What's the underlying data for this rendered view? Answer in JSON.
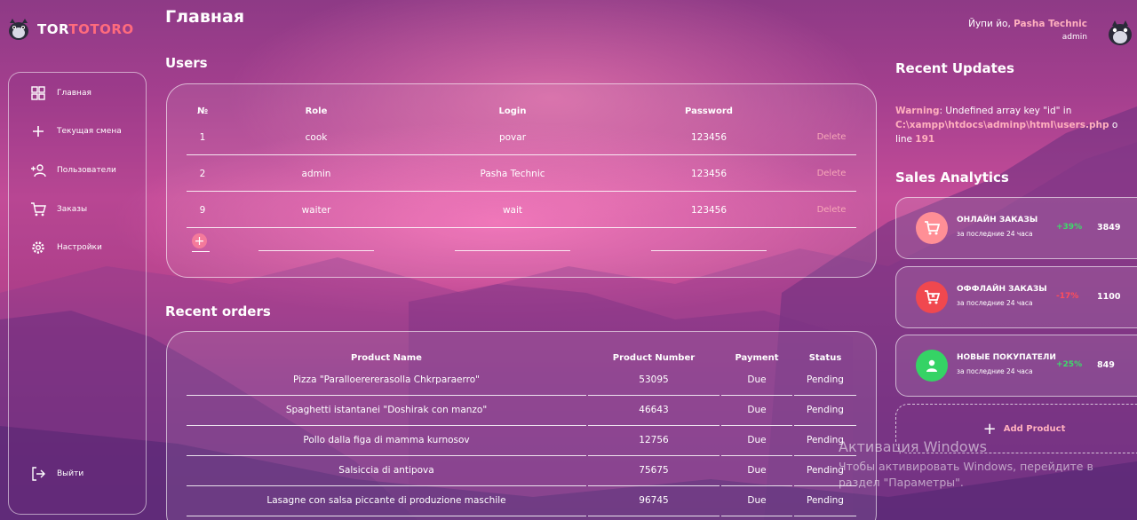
{
  "brand": {
    "part_a": "TOR",
    "part_b": "TOTORO"
  },
  "page_title": "Главная",
  "nav": {
    "home": "Главная",
    "shift": "Текущая смена",
    "users": "Пользователи",
    "orders": "Заказы",
    "settings": "Настройки",
    "logout": "Выйти"
  },
  "users": {
    "title": "Users",
    "headers": {
      "num": "№",
      "role": "Role",
      "login": "Login",
      "password": "Password"
    },
    "rows": [
      {
        "num": "1",
        "role": "cook",
        "login": "povar",
        "password": "123456",
        "action": "Delete"
      },
      {
        "num": "2",
        "role": "admin",
        "login": "Pasha Technic",
        "password": "123456",
        "action": "Delete"
      },
      {
        "num": "9",
        "role": "waiter",
        "login": "wait",
        "password": "123456",
        "action": "Delete"
      }
    ],
    "add_symbol": "+"
  },
  "orders": {
    "title": "Recent orders",
    "headers": {
      "name": "Product Name",
      "number": "Product Number",
      "payment": "Payment",
      "status": "Status"
    },
    "rows": [
      {
        "name": "Pizza \"Paralloerererasolla Chkrparaerro\"",
        "number": "53095",
        "payment": "Due",
        "status": "Pending"
      },
      {
        "name": "Spaghetti istantanei \"Doshirak con manzo\"",
        "number": "46643",
        "payment": "Due",
        "status": "Pending"
      },
      {
        "name": "Pollo dalla figa di mamma kurnosov",
        "number": "12756",
        "payment": "Due",
        "status": "Pending"
      },
      {
        "name": "Salsiccia di antipova",
        "number": "75675",
        "payment": "Due",
        "status": "Pending"
      },
      {
        "name": "Lasagne con salsa piccante di produzione maschile",
        "number": "96745",
        "payment": "Due",
        "status": "Pending"
      }
    ]
  },
  "user_info": {
    "greeting": "Йупи йо, ",
    "name": "Pasha Technic",
    "role": "admin"
  },
  "updates": {
    "title": "Recent Updates",
    "warning_label": "Warning",
    "warning_text": ": Undefined array key \"id\" in",
    "path": "C:\\xampp\\htdocs\\adminp\\html\\users.php",
    "path_suffix": " o",
    "line_prefix": "line ",
    "line_num": "191"
  },
  "sales": {
    "title": "Sales Analytics",
    "cards": [
      {
        "title": "ОНЛАЙН ЗАКАЗЫ",
        "subtitle": "за последние 24 часа",
        "percent": "+39%",
        "value": "3849",
        "color": "#ff8f96",
        "pct_color": "#3ddc6a"
      },
      {
        "title": "ОФФЛАЙН ЗАКАЗЫ",
        "subtitle": "за последние 24 часа",
        "percent": "-17%",
        "value": "1100",
        "color": "#f0484f",
        "pct_color": "#ff4d5a"
      },
      {
        "title": "НОВЫЕ ПОКУПАТЕЛИ",
        "subtitle": "за последние 24 часа",
        "percent": "+25%",
        "value": "849",
        "color": "#35d365",
        "pct_color": "#3ddc6a"
      }
    ],
    "add_product": "Add Product"
  },
  "windows_activation": {
    "title": "Активация Windows",
    "line1": "Чтобы активировать Windows, перейдите в",
    "line2": "раздел \"Параметры\"."
  }
}
